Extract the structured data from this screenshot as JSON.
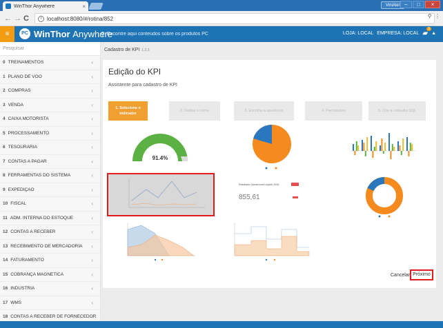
{
  "browser": {
    "tab_title": "WinThor Anywhere",
    "tab_close": "×",
    "user_chip": "ViniAlel",
    "url": "localhost:8080/#/rotina/852",
    "nav_back": "←",
    "nav_forward": "→",
    "nav_reload": "C"
  },
  "header": {
    "menu_icon": "≡",
    "logo_text": "PC",
    "brand_bold": "WinThor",
    "brand_light": "Anywhere",
    "search_placeholder": "Encontre aqui conteúdos sobre os produtos PC",
    "loja_label": "LOJA: LOCAL",
    "empresa_label": "EMPRESA: LOCAL",
    "notification_count": "3"
  },
  "sidebar": {
    "search_placeholder": "Pesquisar",
    "items": [
      {
        "num": "0",
        "label": "TREINAMENTOS"
      },
      {
        "num": "1",
        "label": "PLANO DE VOO"
      },
      {
        "num": "2",
        "label": "COMPRAS"
      },
      {
        "num": "3",
        "label": "VENDA"
      },
      {
        "num": "4",
        "label": "CAIXA MOTORISTA"
      },
      {
        "num": "5",
        "label": "PROCESSAMENTO"
      },
      {
        "num": "6",
        "label": "TESOURARIA"
      },
      {
        "num": "7",
        "label": "CONTAS A PAGAR"
      },
      {
        "num": "8",
        "label": "FERRAMENTAS DO SISTEMA"
      },
      {
        "num": "9",
        "label": "EXPEDIÇÃO"
      },
      {
        "num": "10",
        "label": "FISCAL"
      },
      {
        "num": "11",
        "label": "ADM. INTERNA DO ESTOQUE"
      },
      {
        "num": "12",
        "label": "CONTAS A RECEBER"
      },
      {
        "num": "13",
        "label": "RECEBIMENTO DE MERCADORIA"
      },
      {
        "num": "14",
        "label": "FATURAMENTO"
      },
      {
        "num": "15",
        "label": "COBRANÇA MAGNÉTICA"
      },
      {
        "num": "16",
        "label": "INDUSTRIA"
      },
      {
        "num": "17",
        "label": "WMS"
      },
      {
        "num": "18",
        "label": "CONTAS A RECEBER DE FORNECEDOR"
      }
    ]
  },
  "main": {
    "breadcrumb": "Cadastro de KPI",
    "version": "1.2.3",
    "title": "Edição do KPI",
    "subtitle": "Assistente para cadastro de KPI",
    "steps": [
      {
        "label": "1. Selecione o indicador",
        "active": true
      },
      {
        "label": "2. Defina o nome",
        "active": false
      },
      {
        "label": "3. Escolha a aparência",
        "active": false
      },
      {
        "label": "4. Permissões",
        "active": false
      },
      {
        "label": "5. Crie a consulta SQL",
        "active": false
      }
    ],
    "gauge_value": "91.4%",
    "kpi_card_title": "Resultado Operacional Líquido 2016",
    "kpi_card_value": "855,61",
    "cancel_label": "Cancelar",
    "next_label": "Próximo"
  },
  "colors": {
    "accent_orange": "#f39c12",
    "brand_blue": "#1e73b4",
    "selection_red": "#e31a1c",
    "gauge_green": "#5bb143",
    "pie_orange": "#f58b1f",
    "pie_blue": "#2a77bd"
  }
}
